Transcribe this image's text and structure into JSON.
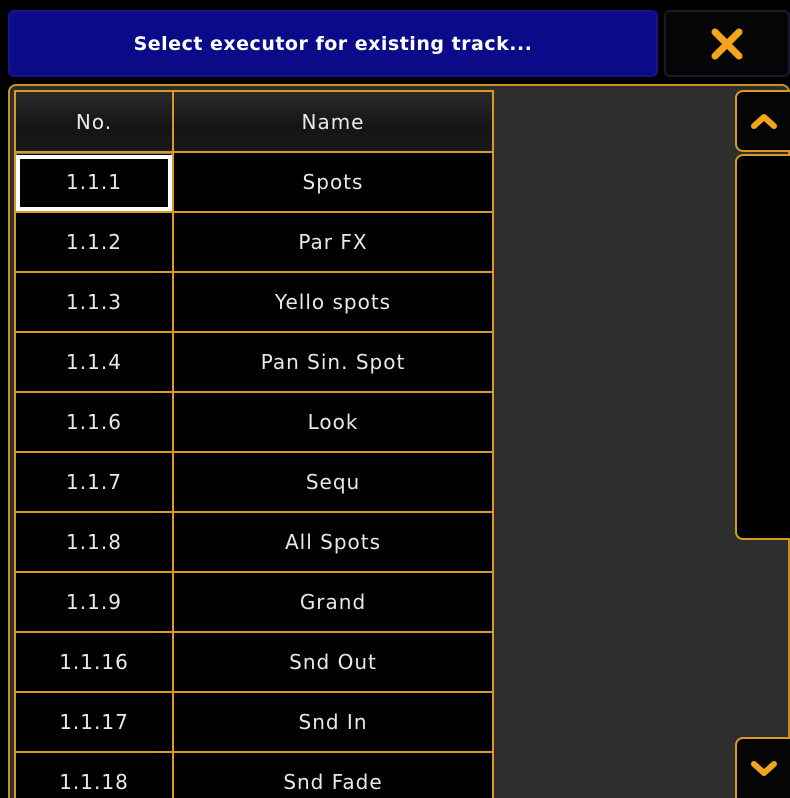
{
  "dialog": {
    "title": "Select executor for existing track..."
  },
  "table": {
    "columns": [
      "No.",
      "Name"
    ],
    "rows": [
      {
        "no": "1.1.1",
        "name": "Spots"
      },
      {
        "no": "1.1.2",
        "name": "Par FX"
      },
      {
        "no": "1.1.3",
        "name": "Yello spots"
      },
      {
        "no": "1.1.4",
        "name": "Pan Sin. Spot"
      },
      {
        "no": "1.1.6",
        "name": "Look"
      },
      {
        "no": "1.1.7",
        "name": "Sequ"
      },
      {
        "no": "1.1.8",
        "name": "All Spots"
      },
      {
        "no": "1.1.9",
        "name": "Grand"
      },
      {
        "no": "1.1.16",
        "name": "Snd Out"
      },
      {
        "no": "1.1.17",
        "name": "Snd In"
      },
      {
        "no": "1.1.18",
        "name": "Snd Fade"
      }
    ]
  },
  "icons": {
    "close": "close-icon",
    "scroll_up": "chevron-up-icon",
    "scroll_down": "chevron-down-icon"
  },
  "colors": {
    "title_bg": "#0b0b8a",
    "accent": "#d89a22",
    "close_icon": "#f2a51a"
  }
}
